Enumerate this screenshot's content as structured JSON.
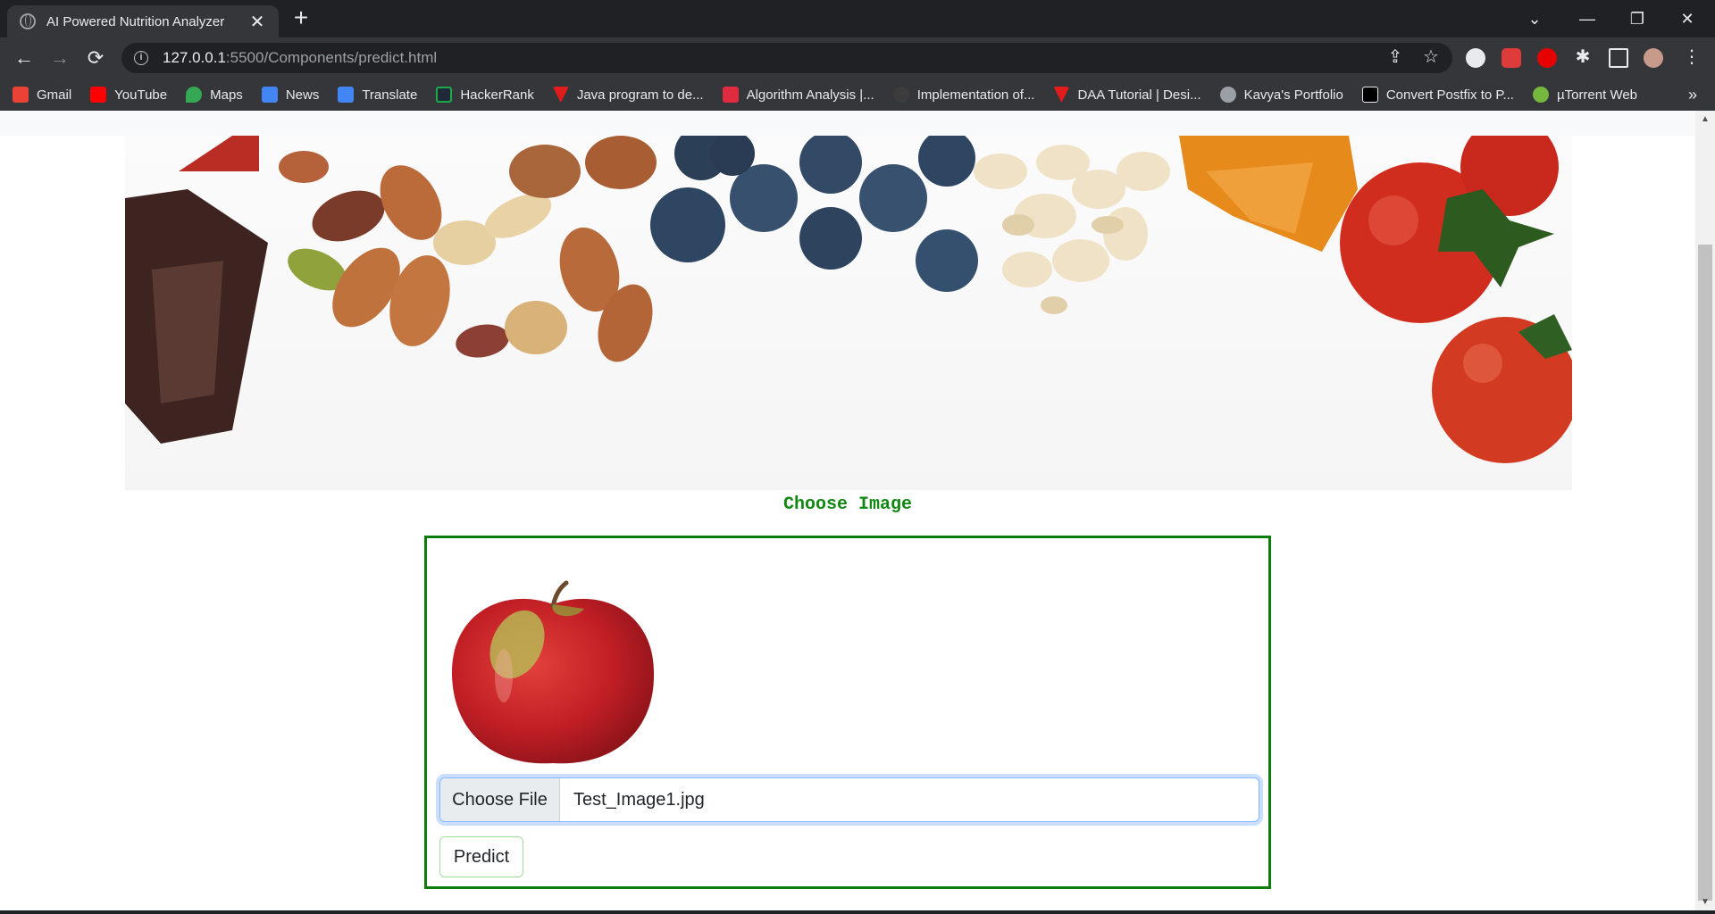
{
  "browser": {
    "tab_title": "AI Powered Nutrition Analyzer",
    "url_host": "127.0.0.1",
    "url_path": ":5500/Components/predict.html",
    "bookmarks": [
      {
        "label": "Gmail",
        "color": "#ea4335"
      },
      {
        "label": "YouTube",
        "color": "#ff0000"
      },
      {
        "label": "Maps",
        "color": "#34a853"
      },
      {
        "label": "News",
        "color": "#4285f4"
      },
      {
        "label": "Translate",
        "color": "#4285f4"
      },
      {
        "label": "HackerRank",
        "color": "#1ba94c"
      },
      {
        "label": "Java program to de...",
        "color": "#e21b1b"
      },
      {
        "label": "Algorithm Analysis |...",
        "color": "#e02a3f"
      },
      {
        "label": "Implementation of...",
        "color": "#3c3c3c"
      },
      {
        "label": "DAA Tutorial | Desi...",
        "color": "#e21b1b"
      },
      {
        "label": "Kavya's Portfolio",
        "color": "#9aa0a6"
      },
      {
        "label": "Convert Postfix to P...",
        "color": "#000000"
      },
      {
        "label": "µTorrent Web",
        "color": "#76b83f"
      }
    ]
  },
  "page": {
    "choose_title": "Choose Image",
    "file_button": "Choose File",
    "file_name": "Test_Image1.jpg",
    "predict_label": "Predict",
    "accent_color": "#0a7d0a"
  }
}
